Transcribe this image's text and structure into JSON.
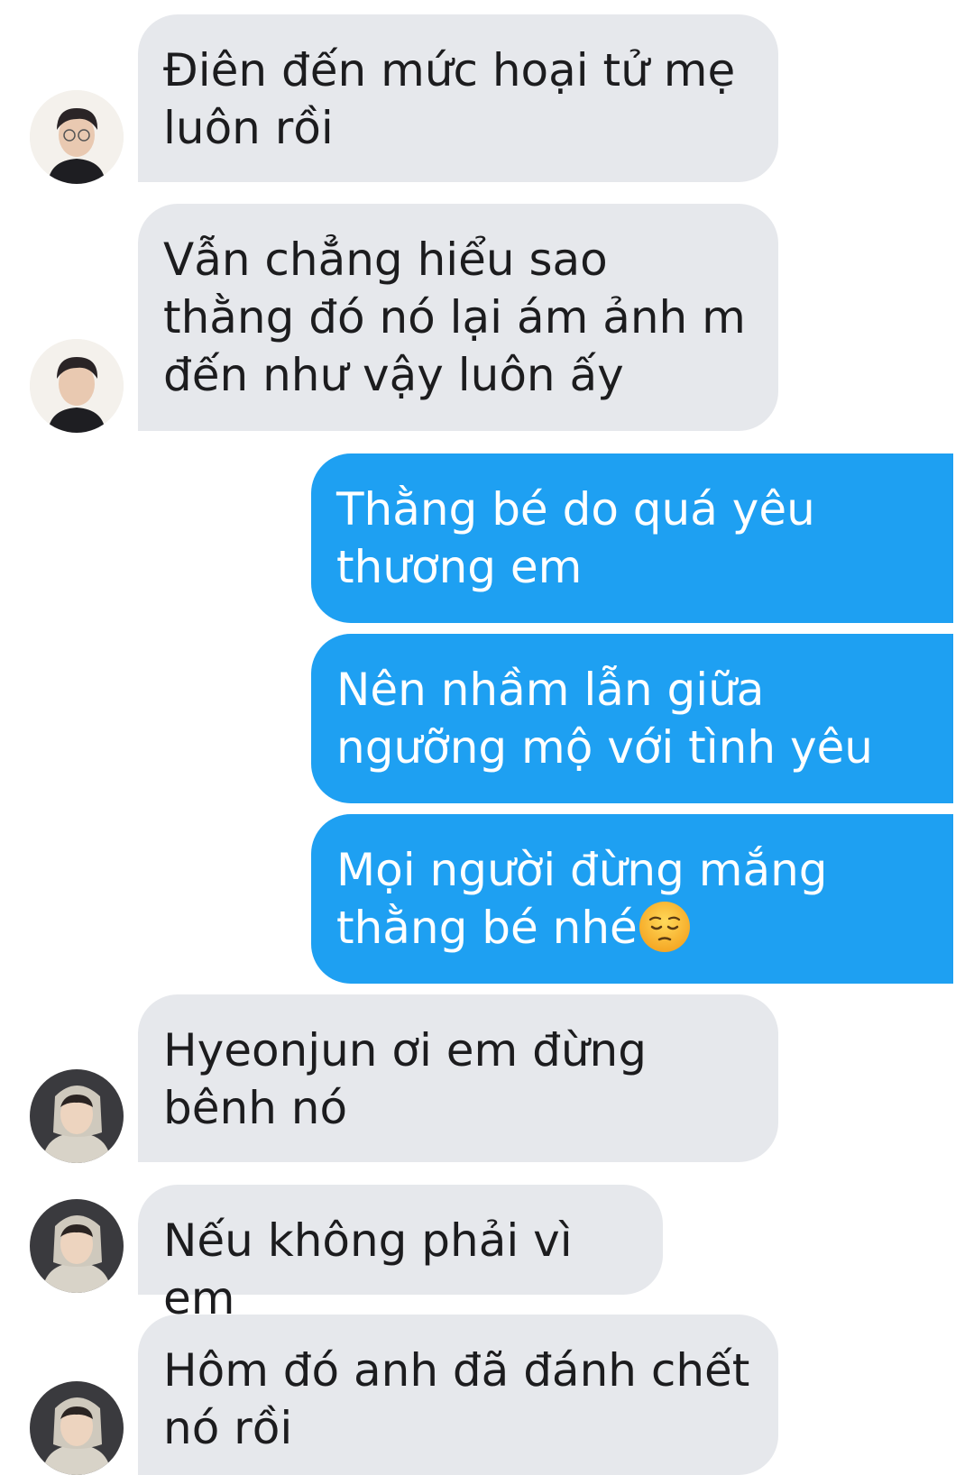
{
  "messages": [
    {
      "direction": "incoming",
      "avatar": "avatar-dark-hair",
      "text": "Điên đến mức hoại tử mẹ luôn rồi"
    },
    {
      "direction": "incoming",
      "avatar": "avatar-dark-hair",
      "text": "Vẫn chẳng hiểu sao thằng đó nó lại ám ảnh m đến như vậy luôn ấy"
    },
    {
      "direction": "outgoing",
      "text": "Thằng bé do quá yêu thương em"
    },
    {
      "direction": "outgoing",
      "text": "Nên nhầm lẫn giữa ngưỡng mộ với tình yêu"
    },
    {
      "direction": "outgoing",
      "text": "Mọi người đừng mắng thằng bé nhé",
      "emoji": "pensive-face"
    },
    {
      "direction": "incoming",
      "avatar": "avatar-hoodie",
      "text": "Hyeonjun ơi em đừng bênh nó"
    },
    {
      "direction": "incoming",
      "avatar": "avatar-hoodie",
      "text": "Nếu không phải vì em"
    },
    {
      "direction": "incoming",
      "avatar": "avatar-hoodie",
      "text": "Hôm đó anh đã đánh chết nó rồi"
    }
  ],
  "colors": {
    "incoming_bubble": "#e6e8ec",
    "outgoing_bubble": "#1ea0f2",
    "incoming_text": "#1c1c1e",
    "outgoing_text": "#ffffff"
  }
}
